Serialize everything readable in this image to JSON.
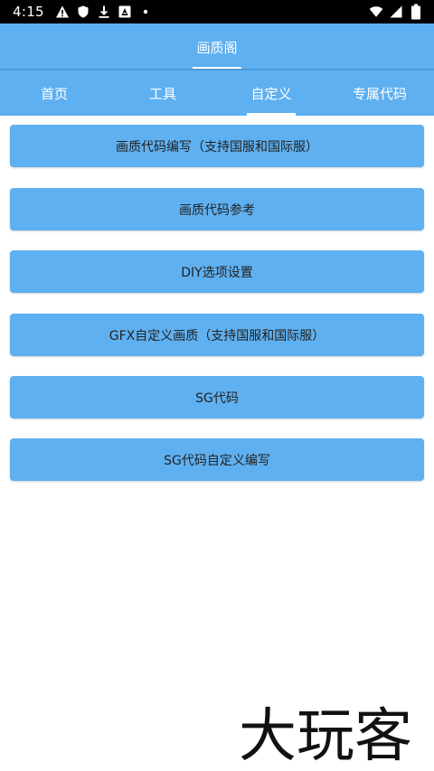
{
  "status_bar": {
    "time": "4:15"
  },
  "header": {
    "title": "画质阁"
  },
  "tabs": [
    {
      "label": "首页"
    },
    {
      "label": "工具"
    },
    {
      "label": "自定义",
      "active": true
    },
    {
      "label": "专属代码"
    }
  ],
  "menu": [
    {
      "label": "画质代码编写（支持国服和国际服）"
    },
    {
      "label": "画质代码参考"
    },
    {
      "label": "DIY选项设置"
    },
    {
      "label": "GFX自定义画质（支持国服和国际服）"
    },
    {
      "label": "SG代码"
    },
    {
      "label": "SG代码自定义编写"
    }
  ],
  "watermark": {
    "text": "大玩客"
  },
  "colors": {
    "primary": "#5fb0f0",
    "status_bar": "#000000",
    "text_on_primary": "#ffffff",
    "button_text": "#222222"
  }
}
